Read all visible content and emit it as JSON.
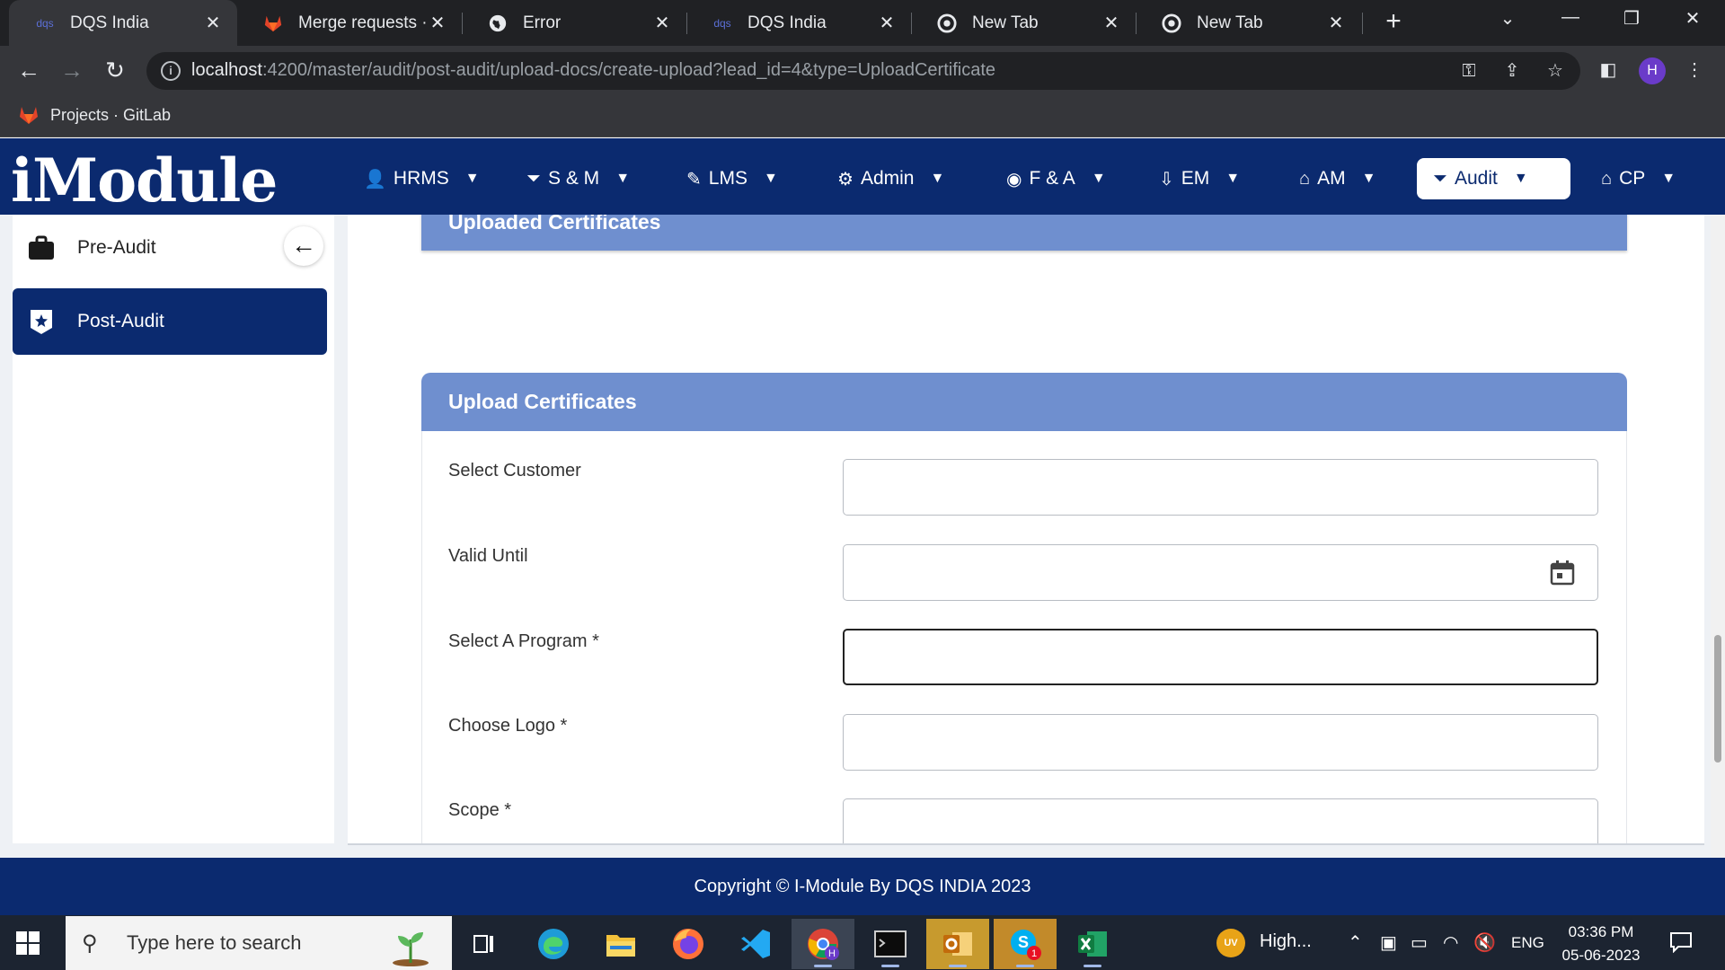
{
  "browser": {
    "tabs": [
      {
        "title": "DQS India",
        "favicon": "dqs-icon",
        "active": true
      },
      {
        "title": "Merge requests · ar",
        "favicon": "gitlab-icon",
        "active": false
      },
      {
        "title": "Error",
        "favicon": "globe-icon",
        "active": false
      },
      {
        "title": "DQS India",
        "favicon": "dqs-icon",
        "active": false
      },
      {
        "title": "New Tab",
        "favicon": "chrome-icon",
        "active": false
      },
      {
        "title": "New Tab",
        "favicon": "chrome-icon",
        "active": false
      }
    ],
    "url_host": "localhost",
    "url_rest": ":4200/master/audit/post-audit/upload-docs/create-upload?lead_id=4&type=UploadCertificate",
    "profile_initial": "H",
    "bookmarks": [
      {
        "label": "Projects · GitLab"
      }
    ]
  },
  "app": {
    "logo": "iModule",
    "menu": [
      {
        "label": "HRMS",
        "icon": "person-icon"
      },
      {
        "label": "S & M",
        "icon": "funnel-dollar-icon"
      },
      {
        "label": "LMS",
        "icon": "edit-icon"
      },
      {
        "label": "Admin",
        "icon": "user-gear-icon"
      },
      {
        "label": "F & A",
        "icon": "finance-icon"
      },
      {
        "label": "EM",
        "icon": "hand-money-icon"
      },
      {
        "label": "AM",
        "icon": "basket-icon"
      },
      {
        "label": "Audit",
        "icon": "funnel-dollar-icon",
        "active": true
      },
      {
        "label": "CP",
        "icon": "basket-icon"
      }
    ],
    "sidebar": [
      {
        "label": "Pre-Audit",
        "icon": "briefcase-icon",
        "active": false
      },
      {
        "label": "Post-Audit",
        "icon": "star-badge-icon",
        "active": true
      }
    ],
    "uploaded_title": "Uploaded Certificates",
    "upload_title": "Upload Certificates",
    "form": [
      {
        "label": "Select Customer",
        "value": ""
      },
      {
        "label": "Valid Until",
        "value": ""
      },
      {
        "label": "Select A Program *",
        "value": ""
      },
      {
        "label": "Choose Logo *",
        "value": ""
      },
      {
        "label": "Scope *",
        "value": ""
      }
    ],
    "footer": "Copyright © I-Module By DQS INDIA 2023"
  },
  "taskbar": {
    "search_placeholder": "Type here to search",
    "weather": "High...",
    "weather_badge": "UV",
    "language": "ENG",
    "time": "03:36 PM",
    "date": "05-06-2023",
    "skype_badge": "1"
  },
  "colors": {
    "primary": "#0b2a6f",
    "panel_header": "#6f8fcf"
  }
}
